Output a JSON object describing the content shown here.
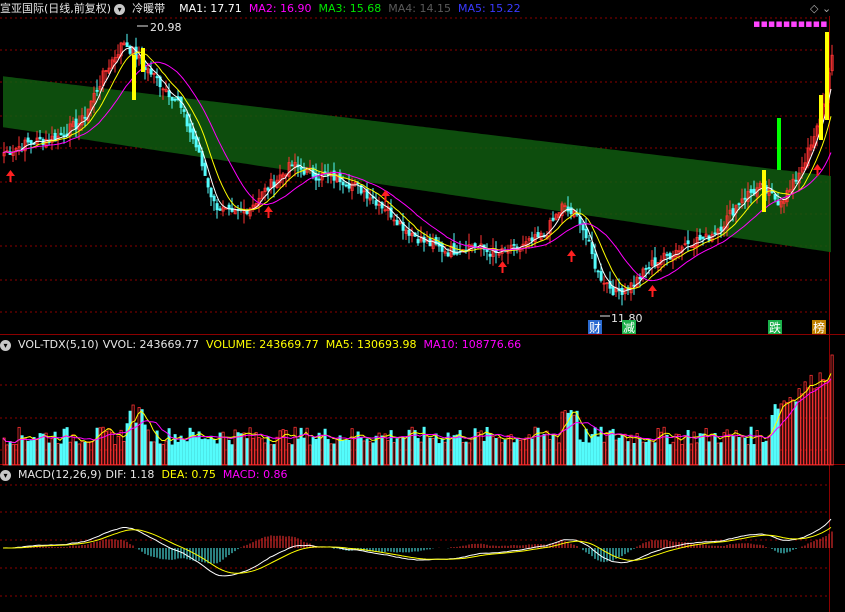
{
  "main_header": {
    "title": "宣亚国际(日线,前复权)",
    "indicator": "冷暖带",
    "ma1": "MA1: 17.71",
    "ma2": "MA2: 16.90",
    "ma3": "MA3: 15.68",
    "ma4": "MA4: 14.15",
    "ma5": "MA5: 15.22"
  },
  "vol_header": {
    "title": "VOL-TDX(5,10)",
    "vvol": "VVOL: 243669.77",
    "volume": "VOLUME: 243669.77",
    "ma5": "MA5: 130693.98",
    "ma10": "MA10: 108776.66"
  },
  "macd_header": {
    "title": "MACD(12,26,9)",
    "dif": "DIF: 1.18",
    "dea": "DEA: 0.75",
    "macd": "MACD: 0.86"
  },
  "annotations": {
    "high": "20.98",
    "low": "11.80",
    "tags": [
      "财",
      "减",
      "跌",
      "榜"
    ]
  },
  "colors": {
    "up": "#ff3232",
    "down": "#54fcfc",
    "ma_white": "#ffffff",
    "ma_yellow": "#ffff00",
    "ma_magenta": "#ff00ff",
    "band": "#0f5a0f",
    "grid": "#8b0000",
    "signal_yellow": "#ffff00",
    "signal_green": "#00ff00"
  },
  "chart_data": [
    {
      "type": "candlestick",
      "title": "宣亚国际(日线,前复权)",
      "price_max": 20.98,
      "price_min": 11.8,
      "series": [
        {
          "name": "MA1",
          "value": 17.71
        },
        {
          "name": "MA2",
          "value": 16.9
        },
        {
          "name": "MA3",
          "value": 15.68
        },
        {
          "name": "MA4",
          "value": 14.15
        },
        {
          "name": "MA5",
          "value": 15.22
        }
      ]
    },
    {
      "type": "bar",
      "title": "VOL-TDX(5,10)",
      "series": [
        {
          "name": "VVOL",
          "value": 243669.77
        },
        {
          "name": "VOLUME",
          "value": 243669.77
        },
        {
          "name": "MA5",
          "value": 130693.98
        },
        {
          "name": "MA10",
          "value": 108776.66
        }
      ]
    },
    {
      "type": "bar",
      "title": "MACD(12,26,9)",
      "series": [
        {
          "name": "DIF",
          "value": 1.18
        },
        {
          "name": "DEA",
          "value": 0.75
        },
        {
          "name": "MACD",
          "value": 0.86
        }
      ]
    }
  ]
}
